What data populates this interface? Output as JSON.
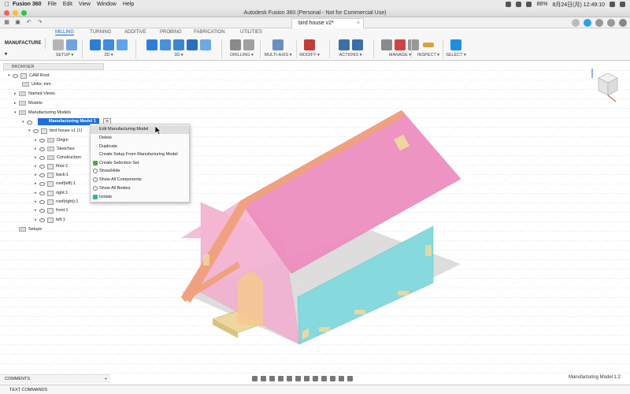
{
  "menubar": {
    "app": "Fusion 360",
    "items": [
      "File",
      "Edit",
      "View",
      "Window",
      "Help"
    ],
    "battery": "86%",
    "clock": "8月24日(月) 12:49:10"
  },
  "titlebar": {
    "title": "Autodesk Fusion 360 (Personal - Not for Commercial Use)"
  },
  "tabstrip": {
    "document_tab": "bird house v2*"
  },
  "toolbar": {
    "workspace": "MANUFACTURE",
    "tabs": [
      "MILLING",
      "TURNING",
      "ADDITIVE",
      "PROBING",
      "FABRICATION",
      "UTILITIES"
    ],
    "active_tab": "MILLING",
    "groups": [
      "SETUP",
      "2D",
      "3D",
      "DRILLING",
      "MULTI-AXIS",
      "MODIFY",
      "ACTIONS",
      "MANAGE",
      "INSPECT",
      "SELECT"
    ]
  },
  "browser": {
    "title": "BROWSER",
    "items": [
      {
        "label": "CAM Root",
        "kind": "component"
      },
      {
        "label": "Units: mm",
        "kind": "doc"
      },
      {
        "label": "Named Views",
        "kind": "folder"
      },
      {
        "label": "Models",
        "kind": "folder"
      },
      {
        "label": "Manufacturing Models",
        "kind": "folder"
      },
      {
        "label": "Manufacturing Model 1",
        "kind": "selected"
      },
      {
        "label": "bird house v1 (1)",
        "kind": "component"
      },
      {
        "label": "Origin",
        "kind": "folder"
      },
      {
        "label": "Sketches",
        "kind": "folder"
      },
      {
        "label": "Construction",
        "kind": "folder"
      },
      {
        "label": "floor:1",
        "kind": "component"
      },
      {
        "label": "back:1",
        "kind": "component"
      },
      {
        "label": "roof(left):1",
        "kind": "component"
      },
      {
        "label": "right:1",
        "kind": "component"
      },
      {
        "label": "roof(right):1",
        "kind": "component"
      },
      {
        "label": "front:1",
        "kind": "component"
      },
      {
        "label": "left:1",
        "kind": "component"
      },
      {
        "label": "Setups",
        "kind": "folder"
      }
    ]
  },
  "context_menu": {
    "items": [
      "Edit Manufacturing Model",
      "Delete",
      "Duplicate",
      "Create Setup From Manufacturing Model",
      "Create Selection Set",
      "Show/Hide",
      "Show All Components",
      "Show All Bodies",
      "Isolate"
    ],
    "highlighted": 0
  },
  "viewcube": {
    "face_label": "FRONT"
  },
  "bottom": {
    "comments": "COMMENTS",
    "text_commands": "TEXT COMMANDS",
    "status": "Manufacturing Model 1:2"
  },
  "colors": {
    "roof": "#ee8fbf",
    "roof_edge": "#f0a17f",
    "wall_pink": "#f2b0d0",
    "wall_cyan": "#86d9dd",
    "floor": "#eed79e",
    "accent": "#1d6fd9"
  }
}
